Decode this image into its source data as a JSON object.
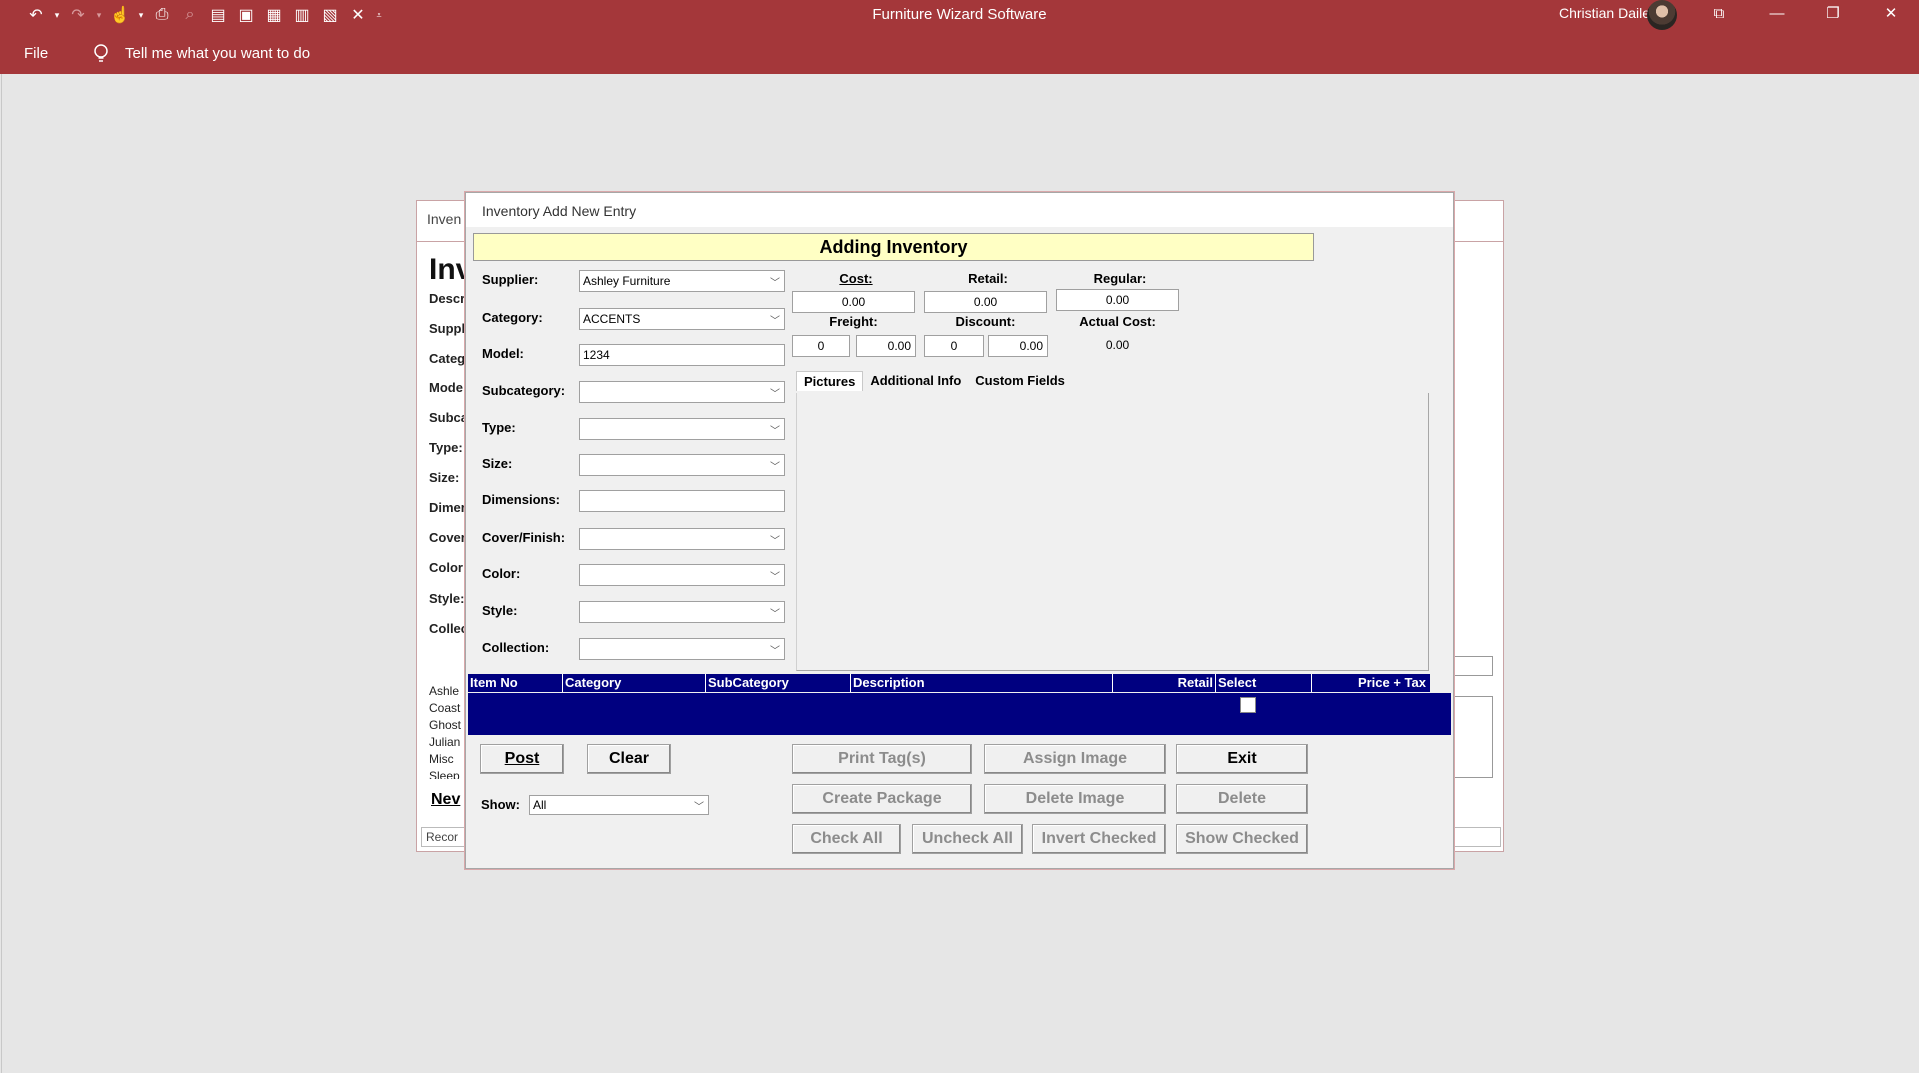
{
  "app": {
    "title": "Furniture Wizard Software",
    "user": "Christian Dailey",
    "accent": "#a4373a"
  },
  "qat": {
    "icons": [
      "undo-icon",
      "redo-icon",
      "touch-mode-icon",
      "print-icon",
      "find-icon",
      "report-icon",
      "excel-icon",
      "word-icon",
      "table-icon",
      "form-icon",
      "close-icon",
      "customize-icon"
    ]
  },
  "menu": {
    "file": "File",
    "tell_me": "Tell me what you want to do"
  },
  "background_form": {
    "tab": "Inven",
    "heading": "Inv",
    "labels": [
      "Descr",
      "Suppl",
      "Categ",
      "Mode",
      "Subca",
      "Type:",
      "Size:",
      "Dimer",
      "Cover",
      "Color:",
      "Style:",
      "Collec"
    ],
    "list": [
      "Ashle",
      "Coast",
      "Ghost",
      "Julian",
      "Misc",
      "Sleep"
    ],
    "new_button": "Nev",
    "record": "Recor"
  },
  "dialog": {
    "title": "Inventory Add New Entry",
    "banner": "Adding Inventory",
    "fields": {
      "supplier": {
        "label": "Supplier:",
        "value": "Ashley Furniture"
      },
      "category": {
        "label": "Category:",
        "value": "ACCENTS"
      },
      "model": {
        "label": "Model:",
        "value": "1234"
      },
      "subcategory": {
        "label": "Subcategory:",
        "value": ""
      },
      "type": {
        "label": "Type:",
        "value": ""
      },
      "size": {
        "label": "Size:",
        "value": ""
      },
      "dimensions": {
        "label": "Dimensions:",
        "value": ""
      },
      "cover_finish": {
        "label": "Cover/Finish:",
        "value": ""
      },
      "color": {
        "label": "Color:",
        "value": ""
      },
      "style": {
        "label": "Style:",
        "value": ""
      },
      "collection": {
        "label": "Collection:",
        "value": ""
      }
    },
    "pricing": {
      "cost_label": "Cost:",
      "cost": "0.00",
      "retail_label": "Retail:",
      "retail": "0.00",
      "regular_label": "Regular:",
      "regular": "0.00",
      "freight_label": "Freight:",
      "freight_qty": "0",
      "freight_amt": "0.00",
      "discount_label": "Discount:",
      "discount_qty": "0",
      "discount_amt": "0.00",
      "actual_cost_label": "Actual Cost:",
      "actual_cost": "0.00"
    },
    "tabs": [
      "Pictures",
      "Additional Info",
      "Custom Fields"
    ],
    "grid": {
      "columns": [
        "Item No",
        "Category",
        "SubCategory",
        "Description",
        "Retail",
        "Select",
        "Price + Tax"
      ],
      "header_color": "#000080"
    },
    "buttons": {
      "post": "Post",
      "clear": "Clear",
      "print_tags": "Print Tag(s)",
      "assign_image": "Assign Image",
      "exit": "Exit",
      "create_package": "Create Package",
      "delete_image": "Delete Image",
      "delete": "Delete",
      "check_all": "Check All",
      "uncheck_all": "Uncheck All",
      "invert_checked": "Invert Checked",
      "show_checked": "Show Checked"
    },
    "show": {
      "label": "Show:",
      "value": "All"
    }
  }
}
